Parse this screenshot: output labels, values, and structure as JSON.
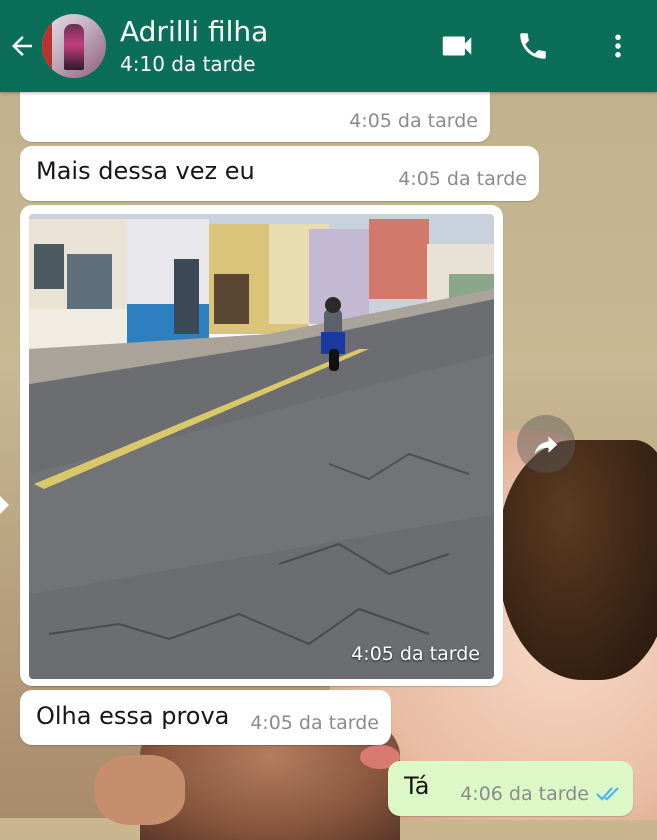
{
  "header": {
    "contact_name": "Adrilli filha",
    "last_seen": "4:10 da tarde",
    "icons": [
      "back-arrow-icon",
      "video-call-icon",
      "phone-icon",
      "more-vert-icon"
    ]
  },
  "messages": [
    {
      "type": "text",
      "direction": "in",
      "text": "",
      "time": "4:05 da tarde"
    },
    {
      "type": "text",
      "direction": "in",
      "text": "Mais dessa vez eu",
      "time": "4:05 da tarde"
    },
    {
      "type": "image",
      "direction": "in",
      "time": "4:05 da tarde"
    },
    {
      "type": "text",
      "direction": "in",
      "text": "Olha essa prova",
      "time": "4:05 da tarde"
    },
    {
      "type": "text",
      "direction": "out",
      "text": "Tá",
      "time": "4:06 da tarde",
      "status": "read"
    }
  ],
  "colors": {
    "header": "#0a6e59",
    "incoming_bubble": "#ffffff",
    "outgoing_bubble": "#dcf8c6",
    "read_ticks": "#4fb6ec"
  }
}
